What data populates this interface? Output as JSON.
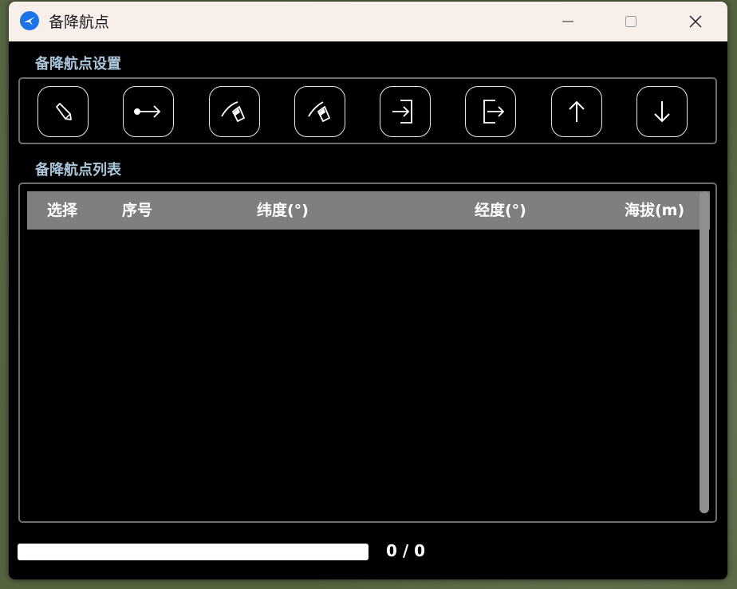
{
  "window": {
    "title": "备降航点",
    "controls": {
      "minimize": "minimize",
      "maximize": "maximize",
      "close": "close"
    }
  },
  "settings": {
    "label": "备降航点设置",
    "tools": [
      {
        "icon": "pencil-icon"
      },
      {
        "icon": "point-arrow-icon"
      },
      {
        "icon": "fill-bucket-icon"
      },
      {
        "icon": "fill-bucket-alt-icon"
      },
      {
        "icon": "import-icon"
      },
      {
        "icon": "export-icon"
      },
      {
        "icon": "arrow-up-icon"
      },
      {
        "icon": "arrow-down-icon"
      }
    ]
  },
  "list": {
    "label": "备降航点列表",
    "columns": [
      "选择",
      "序号",
      "纬度(°)",
      "经度(°)",
      "海拔(m)"
    ],
    "rows": []
  },
  "progress": {
    "value": 0,
    "text": "0 / 0"
  },
  "colors": {
    "section_label": "#a9c6db",
    "header_bg": "#7f7f7f",
    "titlebar_bg": "#f8efea",
    "app_icon": "#1a73e8"
  }
}
